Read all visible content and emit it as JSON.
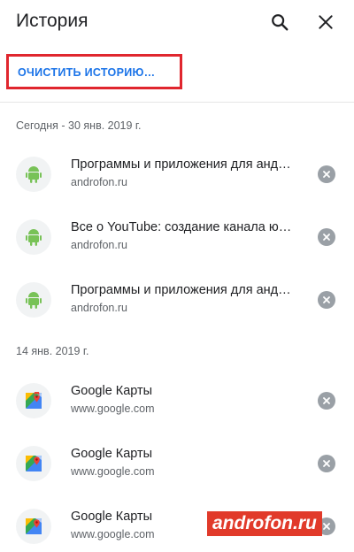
{
  "header": {
    "title": "История",
    "search_icon": "search-icon",
    "close_icon": "close-icon"
  },
  "clear_history": {
    "label": "ОЧИСТИТЬ ИСТОРИЮ…"
  },
  "sections": [
    {
      "date": "Сегодня - 30 янв. 2019 г.",
      "items": [
        {
          "title": "Программы и приложения для анд…",
          "url": "androfon.ru",
          "icon": "android-icon"
        },
        {
          "title": "Все о YouTube: создание канала ю…",
          "url": "androfon.ru",
          "icon": "android-icon"
        },
        {
          "title": "Программы и приложения для анд…",
          "url": "androfon.ru",
          "icon": "android-icon"
        }
      ]
    },
    {
      "date": "14 янв. 2019 г.",
      "items": [
        {
          "title": "Google Карты",
          "url": "www.google.com",
          "icon": "google-maps-icon"
        },
        {
          "title": "Google Карты",
          "url": "www.google.com",
          "icon": "google-maps-icon"
        },
        {
          "title": "Google Карты",
          "url": "www.google.com",
          "icon": "google-maps-icon"
        }
      ]
    }
  ],
  "watermark": {
    "text": "androfon.ru"
  },
  "colors": {
    "accent": "#1a73e8",
    "highlight_box": "#e0262e",
    "android_green": "#78c257",
    "remove_grey": "#9aa0a6",
    "watermark_red": "#e13a2a"
  }
}
